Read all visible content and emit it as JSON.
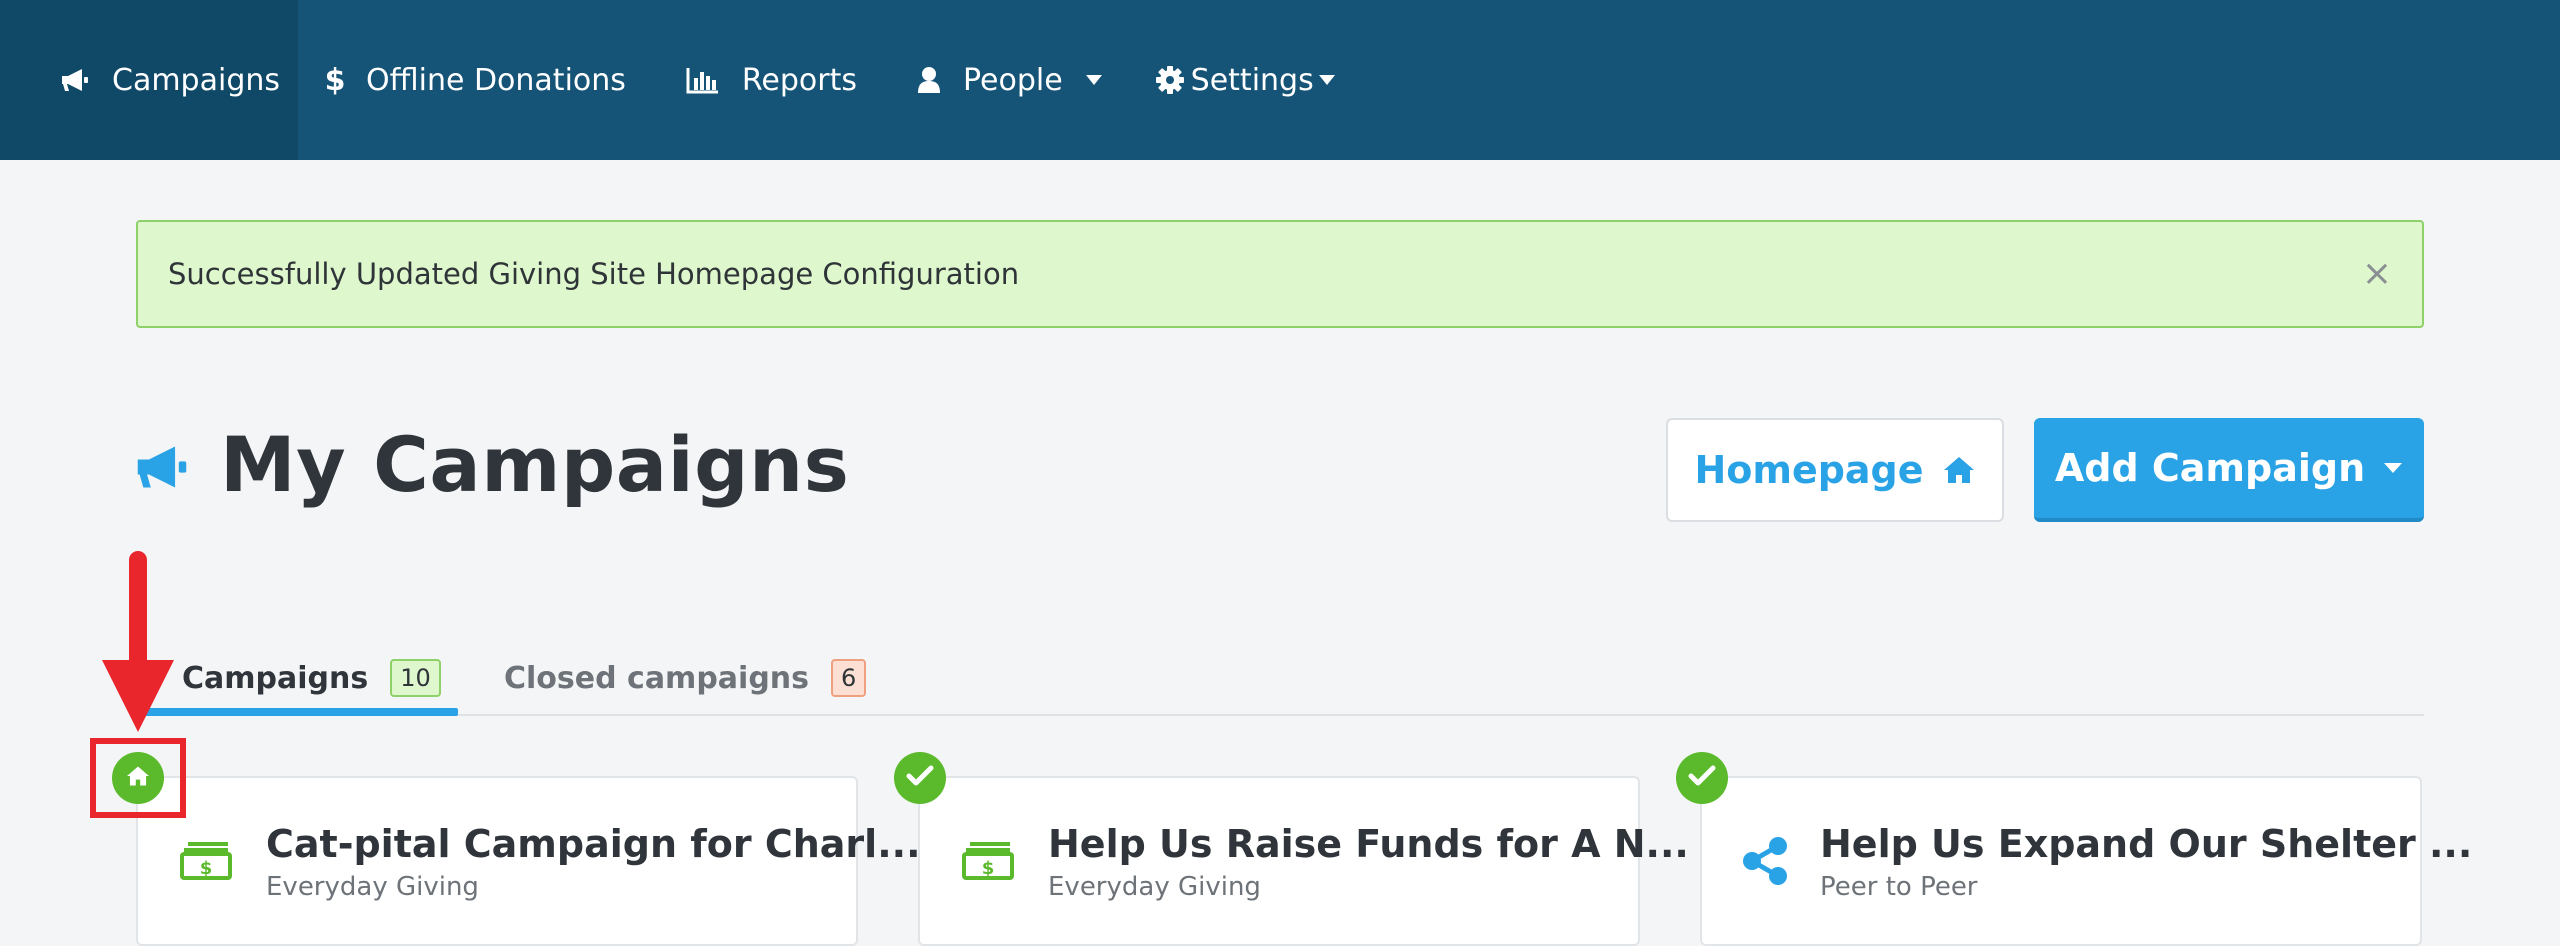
{
  "nav": {
    "items": [
      {
        "label": "Campaigns",
        "icon": "megaphone-icon",
        "active": true
      },
      {
        "label": "Offline Donations",
        "icon": "dollar-icon"
      },
      {
        "label": "Reports",
        "icon": "bar-chart-icon"
      },
      {
        "label": "People",
        "icon": "user-icon",
        "dropdown": true
      },
      {
        "label": "Settings",
        "icon": "gear-icon",
        "dropdown": true
      }
    ]
  },
  "alert": {
    "message": "Successfully Updated Giving Site Homepage Configuration",
    "close_symbol": "×"
  },
  "header": {
    "title": "My Campaigns",
    "icon": "megaphone-icon",
    "homepage_button": "Homepage",
    "add_button": "Add Campaign"
  },
  "tabs": [
    {
      "label": "Campaigns",
      "count": "10",
      "active": true
    },
    {
      "label": "Closed campaigns",
      "count": "6",
      "active": false
    }
  ],
  "cards": [
    {
      "title": "Cat-pital Campaign for Charl...",
      "type": "Everyday Giving",
      "icon": "money-icon",
      "status": "home-icon"
    },
    {
      "title": "Help Us Raise Funds for A N...",
      "type": "Everyday Giving",
      "icon": "money-icon",
      "status": "check-icon"
    },
    {
      "title": "Help Us Expand Our Shelter ...",
      "type": "Peer to Peer",
      "icon": "share-icon",
      "status": "check-icon"
    }
  ],
  "colors": {
    "navbar": "#155477",
    "navbar_active": "#104867",
    "accent": "#2aa3e6",
    "success": "#5bb92c",
    "alert_bg": "#def7cd",
    "annotation": "#e8262b"
  }
}
